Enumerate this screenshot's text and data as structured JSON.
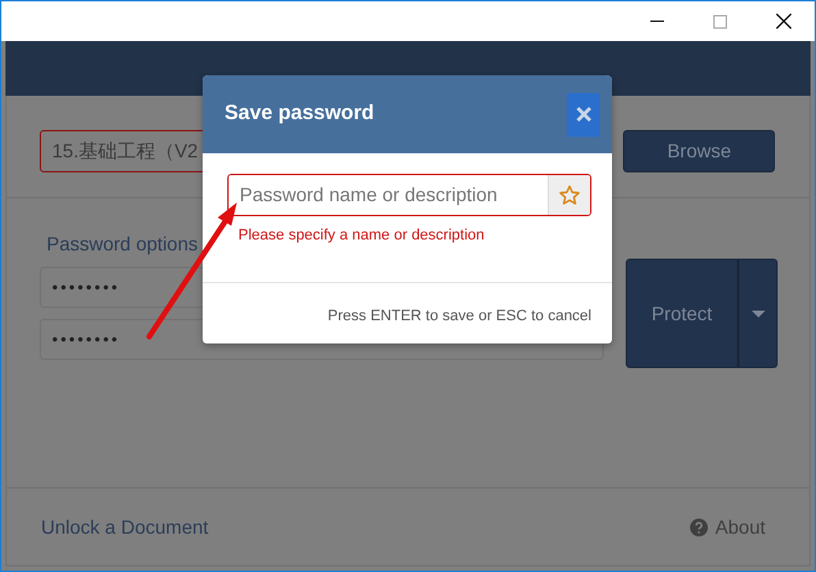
{
  "document_field": {
    "value": "15.基础工程（V2",
    "invalid": true
  },
  "browse_button": {
    "label": "Browse"
  },
  "password_options": {
    "label": "Password options"
  },
  "password_fields": [
    {
      "value": "••••••••"
    },
    {
      "value": "••••••••"
    }
  ],
  "protect_button": {
    "label": "Protect"
  },
  "footer": {
    "unlock_link": "Unlock a Document",
    "about_link": "About"
  },
  "dialog": {
    "title": "Save password",
    "name_field": {
      "placeholder": "Password name or description",
      "invalid": true
    },
    "error": "Please specify a name or description",
    "hint": "Press ENTER to save or ESC to cancel"
  }
}
